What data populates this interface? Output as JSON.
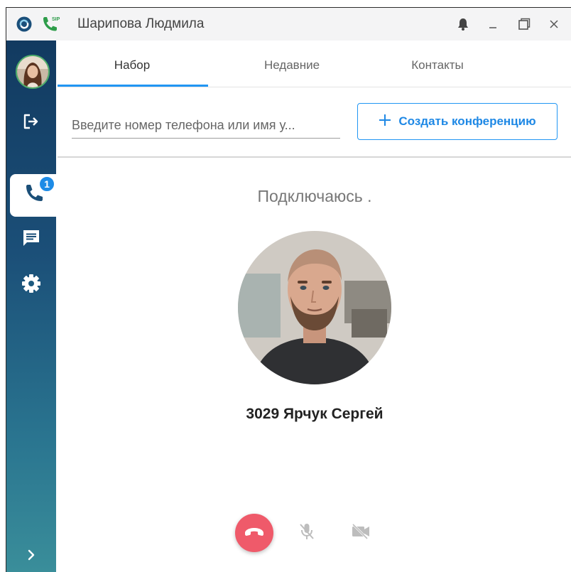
{
  "window": {
    "title": "Шарипова Людмила",
    "icons": {
      "app_logo": "app-logo-icon",
      "sip": "sip-phone-icon",
      "bell": "bell-icon",
      "minimize": "minimize-icon",
      "maximize": "maximize-icon",
      "close": "close-icon"
    },
    "minimize_label": "_",
    "close_label": "×"
  },
  "sidebar": {
    "items": [
      {
        "name": "user-avatar",
        "icon": "avatar"
      },
      {
        "name": "logout",
        "icon": "logout-icon"
      },
      {
        "name": "calls",
        "icon": "phone-icon",
        "active": true,
        "badge": "1"
      },
      {
        "name": "chat",
        "icon": "chat-icon"
      },
      {
        "name": "settings",
        "icon": "gear-icon"
      },
      {
        "name": "expand",
        "icon": "chevron-right-icon"
      }
    ],
    "expand_label": "›"
  },
  "tabs": [
    {
      "label": "Набор",
      "active": true
    },
    {
      "label": "Недавние",
      "active": false
    },
    {
      "label": "Контакты",
      "active": false
    }
  ],
  "dial": {
    "search_placeholder": "Введите номер телефона или имя у...",
    "conference_button": "Создать конференцию",
    "conference_icon": "plus-icon"
  },
  "call": {
    "status": "Подключаюсь .",
    "contact_name": "3029 Ярчук Сергей",
    "controls": [
      {
        "name": "hangup",
        "icon": "hangup-icon"
      },
      {
        "name": "mute",
        "icon": "mic-off-icon"
      },
      {
        "name": "video",
        "icon": "video-off-icon"
      }
    ]
  },
  "colors": {
    "accent": "#2196f3",
    "sidebar_top": "#123a60",
    "sidebar_bottom": "#3a8e9a",
    "hangup": "#ef5a6a",
    "badge": "#1d8be6",
    "sip_green": "#2e9d4a"
  }
}
